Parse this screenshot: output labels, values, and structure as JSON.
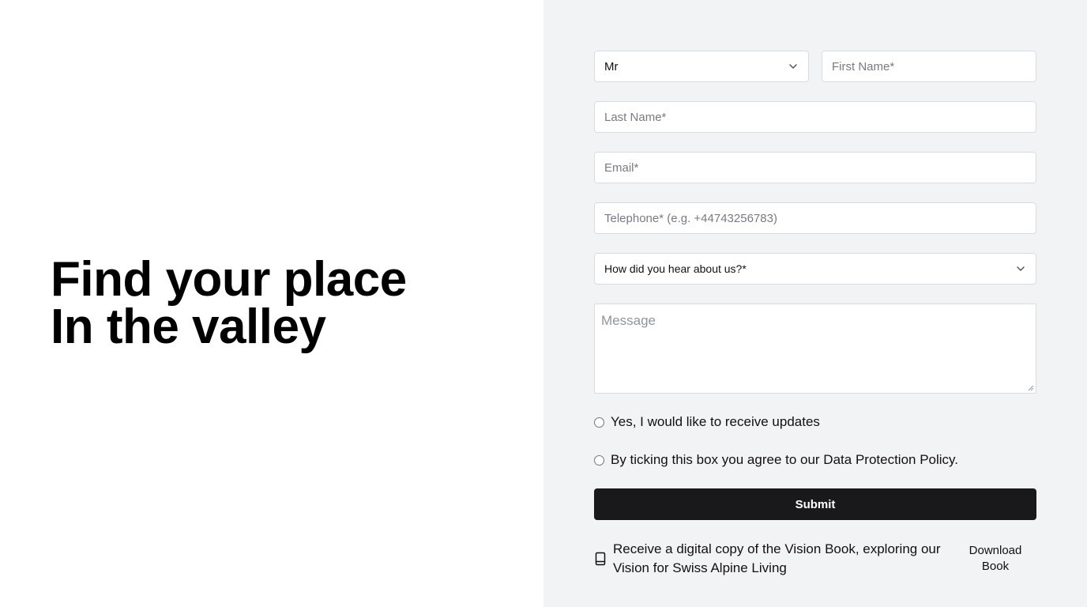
{
  "hero": {
    "line1": "Find your place",
    "line2": "In the valley"
  },
  "form": {
    "title_select": {
      "value": "Mr"
    },
    "first_name": {
      "placeholder": "First Name*"
    },
    "last_name": {
      "placeholder": "Last Name*"
    },
    "email": {
      "placeholder": "Email*"
    },
    "telephone": {
      "placeholder": "Telephone* (e.g. +44743256783)"
    },
    "source_select": {
      "value": "How did you hear about us?*"
    },
    "message": {
      "placeholder": "Message"
    },
    "updates_label": "Yes, I would like to receive updates",
    "policy_label": "By ticking this box you agree to our Data Protection Policy.",
    "submit_label": "Submit"
  },
  "book": {
    "icon": "book-icon",
    "text": "Receive a digital copy of the Vision Book, exploring our Vision for Swiss Alpine Living",
    "download_label": "Download Book"
  },
  "colors": {
    "panel_bg": "#f2f3f5",
    "submit_bg": "#19191b",
    "border": "#d9dce1"
  }
}
